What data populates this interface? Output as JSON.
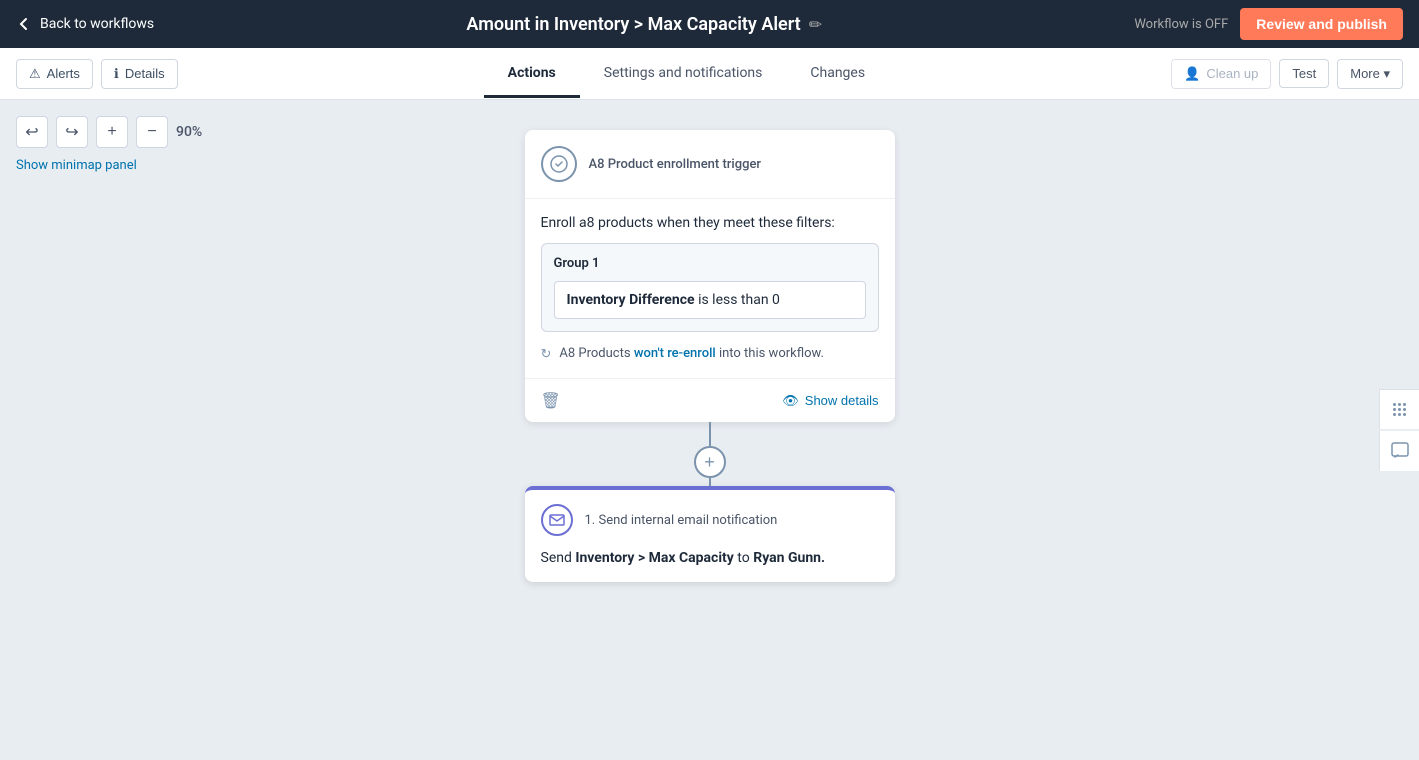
{
  "topNav": {
    "backLabel": "Back to workflows",
    "workflowTitle": "Amount in Inventory > Max Capacity Alert",
    "workflowStatus": "Workflow is OFF",
    "publishLabel": "Review and publish",
    "editIconLabel": "✏"
  },
  "tabBar": {
    "alertsLabel": "Alerts",
    "detailsLabel": "Details",
    "tabs": [
      {
        "id": "actions",
        "label": "Actions",
        "active": true
      },
      {
        "id": "settings",
        "label": "Settings and notifications",
        "active": false
      },
      {
        "id": "changes",
        "label": "Changes",
        "active": false
      }
    ],
    "cleanupLabel": "Clean up",
    "testLabel": "Test",
    "moreLabel": "More ▾"
  },
  "canvas": {
    "zoomLevel": "90%",
    "minimapLabel": "Show minimap panel"
  },
  "triggerCard": {
    "triggerName": "A8 Product enrollment trigger",
    "enrollDesc": "Enroll a8 products when they meet these filters:",
    "groupLabel": "Group 1",
    "filterText": "Inventory Difference",
    "filterCondition": "is less than",
    "filterValue": "0",
    "reEnrollText1": "A8 Products",
    "reEnrollLink": "won't re-enroll",
    "reEnrollText2": "into this workflow.",
    "showDetailsLabel": "Show details"
  },
  "actionCard": {
    "stepNumber": "1.",
    "actionName": "Send internal email notification",
    "sendText": "Send",
    "boldPart": "Inventory > Max Capacity",
    "sendText2": "to",
    "recipient": "Ryan Gunn."
  },
  "colors": {
    "accent": "#6b6fd4",
    "orange": "#ff7a59",
    "dark": "#1e2a3a",
    "link": "#0073ae"
  }
}
